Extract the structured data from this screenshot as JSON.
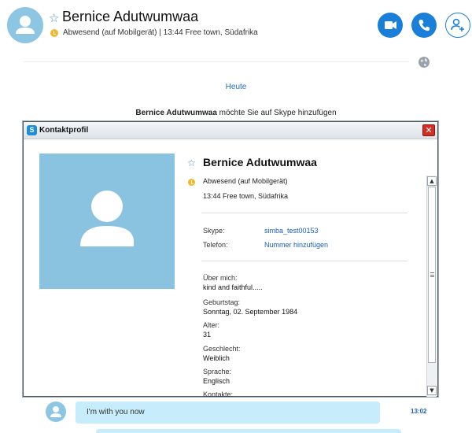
{
  "header": {
    "contact_name": "Bernice Adutwumwaa",
    "status_line": "Abwesend (auf Mobilgerät)  |  13:44 Free town, Südafrika",
    "star_icon": "star-outline-icon",
    "buttons": {
      "video_icon": "video-camera-icon",
      "call_icon": "phone-icon",
      "add_icon": "add-person-icon"
    }
  },
  "conversation": {
    "day_label": "Heute",
    "request_name": "Bernice Adutwumwaa",
    "request_text": " möchte Sie auf Skype hinzufügen"
  },
  "profile_dialog": {
    "title": "Kontaktprofil",
    "close_symbol": "✕",
    "name": "Bernice Adutwumwaa",
    "status": "Abwesend (auf Mobilgerät)",
    "local_time_location": "13:44 Free town, Südafrika",
    "skype_label": "Skype:",
    "skype_value": "simba_test00153",
    "phone_label": "Telefon:",
    "phone_value": "Nummer hinzufügen",
    "about_label": "Über mich:",
    "about_value": "kind and faithful.....",
    "birthday_label": "Geburtstag:",
    "birthday_value": "Sonntag, 02. September 1984",
    "age_label": "Alter:",
    "age_value": "31",
    "gender_label": "Geschlecht:",
    "gender_value": "Weiblich",
    "language_label": "Sprache:",
    "language_value": "Englisch",
    "contacts_label": "Kontakte:"
  },
  "message": {
    "text": "I'm with you now",
    "time": "13:02"
  },
  "colors": {
    "accent": "#1a7fd8",
    "bubble": "#c7ecfb",
    "avatar": "#8cc6e2",
    "away": "#f5b72a",
    "close": "#d22e24"
  }
}
